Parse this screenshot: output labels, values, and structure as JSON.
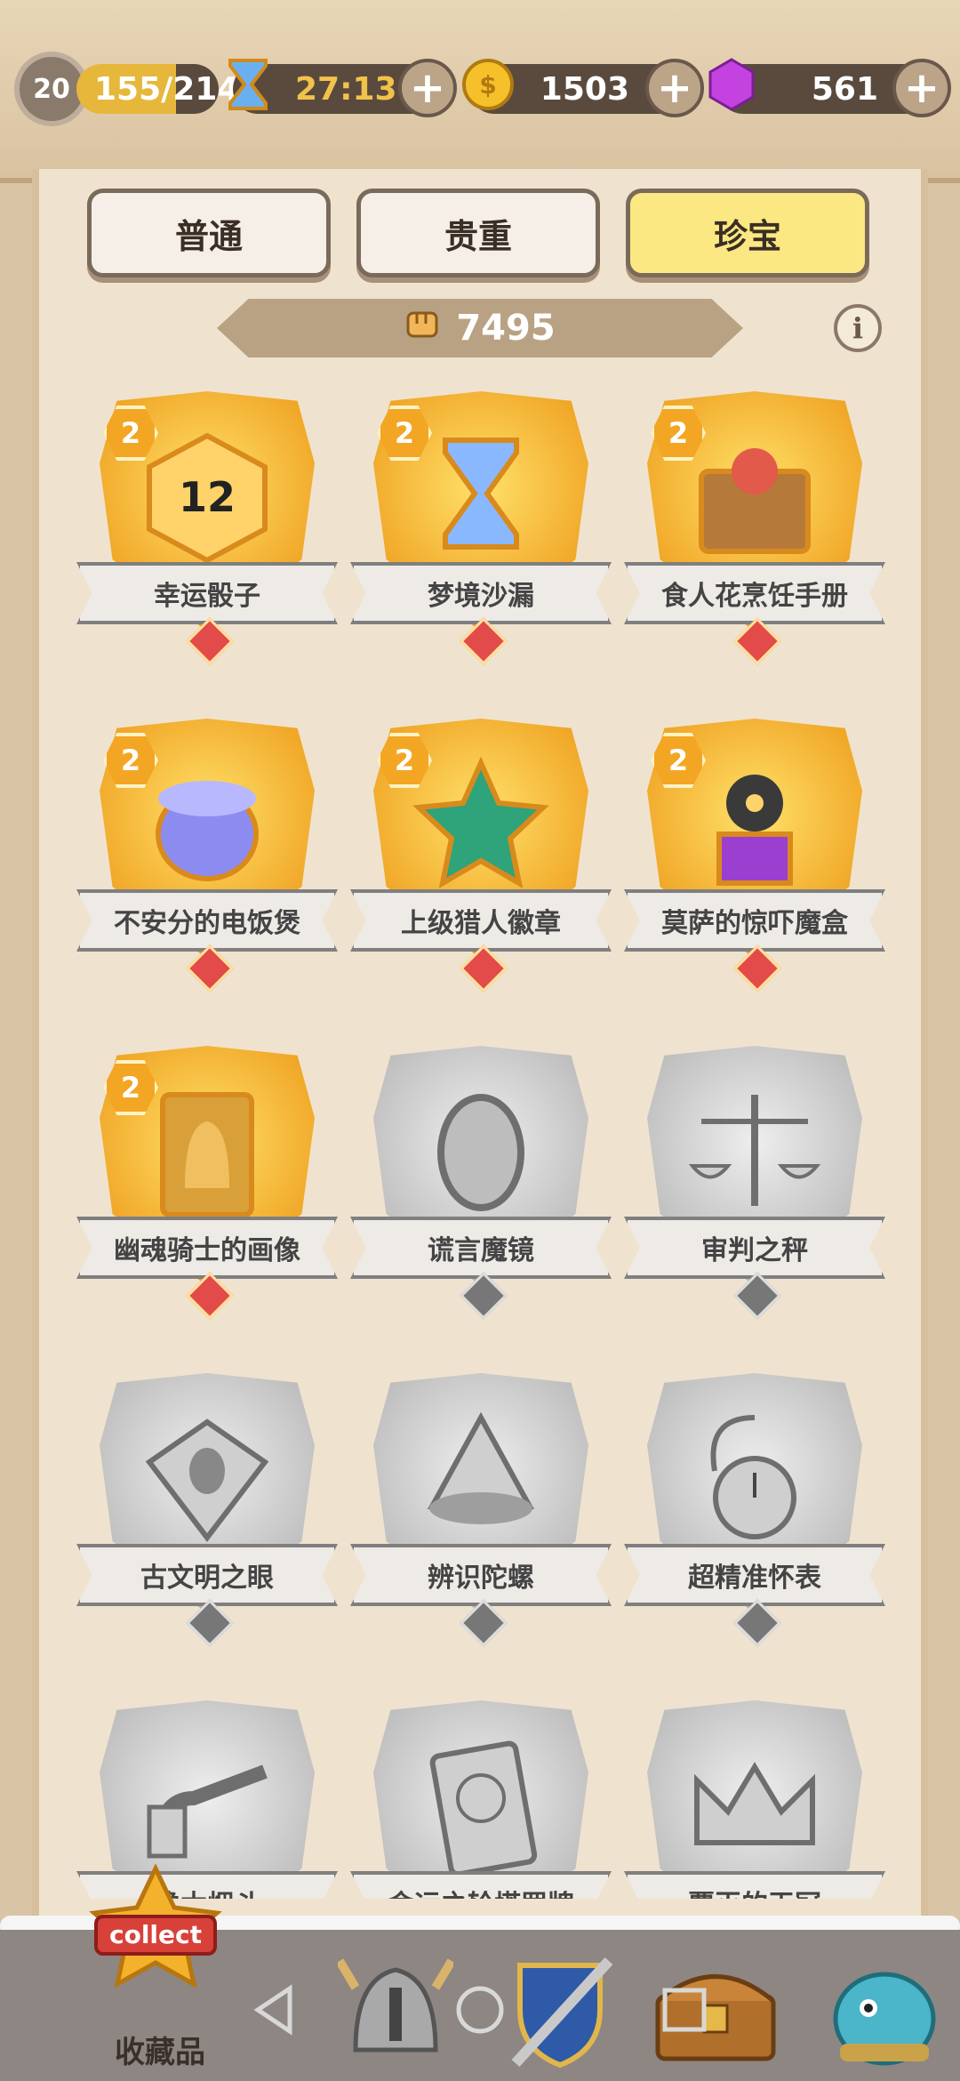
{
  "header": {
    "level": "20",
    "xp": "155/214",
    "timer": "27:13",
    "coins": "1503",
    "gems": "561",
    "plus_label": "+"
  },
  "tabs": [
    {
      "label": "普通",
      "active": false
    },
    {
      "label": "贵重",
      "active": false
    },
    {
      "label": "珍宝",
      "active": true
    }
  ],
  "banner": {
    "value": "7495",
    "info_label": "i"
  },
  "items": [
    {
      "name": "幸运骰子",
      "count": "2",
      "owned": true,
      "icon": "dice-icon"
    },
    {
      "name": "梦境沙漏",
      "count": "2",
      "owned": true,
      "icon": "hourglass-icon"
    },
    {
      "name": "食人花烹饪手册",
      "count": "2",
      "owned": true,
      "icon": "cookbook-icon"
    },
    {
      "name": "不安分的电饭煲",
      "count": "2",
      "owned": true,
      "icon": "rice-cooker-icon"
    },
    {
      "name": "上级猎人徽章",
      "count": "2",
      "owned": true,
      "icon": "badge-icon"
    },
    {
      "name": "莫萨的惊吓魔盒",
      "count": "2",
      "owned": true,
      "icon": "jack-in-box-icon"
    },
    {
      "name": "幽魂骑士的画像",
      "count": "2",
      "owned": true,
      "icon": "knight-portrait-icon"
    },
    {
      "name": "谎言魔镜",
      "count": "",
      "owned": false,
      "icon": "mirror-icon"
    },
    {
      "name": "审判之秤",
      "count": "",
      "owned": false,
      "icon": "scales-icon"
    },
    {
      "name": "古文明之眼",
      "count": "",
      "owned": false,
      "icon": "eye-icon"
    },
    {
      "name": "辨识陀螺",
      "count": "",
      "owned": false,
      "icon": "spinning-top-icon"
    },
    {
      "name": "超精准怀表",
      "count": "",
      "owned": false,
      "icon": "pocket-watch-icon"
    },
    {
      "name": "橡木烟斗",
      "count": "",
      "owned": false,
      "icon": "pipe-icon"
    },
    {
      "name": "命运之轮塔罗牌",
      "count": "",
      "owned": false,
      "icon": "tarot-card-icon"
    },
    {
      "name": "覆灭的王冠",
      "count": "",
      "owned": false,
      "icon": "crown-icon"
    }
  ],
  "bottom_nav": {
    "collect_badge": "collect",
    "collect_label": "收藏品"
  },
  "colors": {
    "gold": "#f0a424",
    "silver": "#bdbdbd",
    "active_tab": "#fbe882"
  }
}
